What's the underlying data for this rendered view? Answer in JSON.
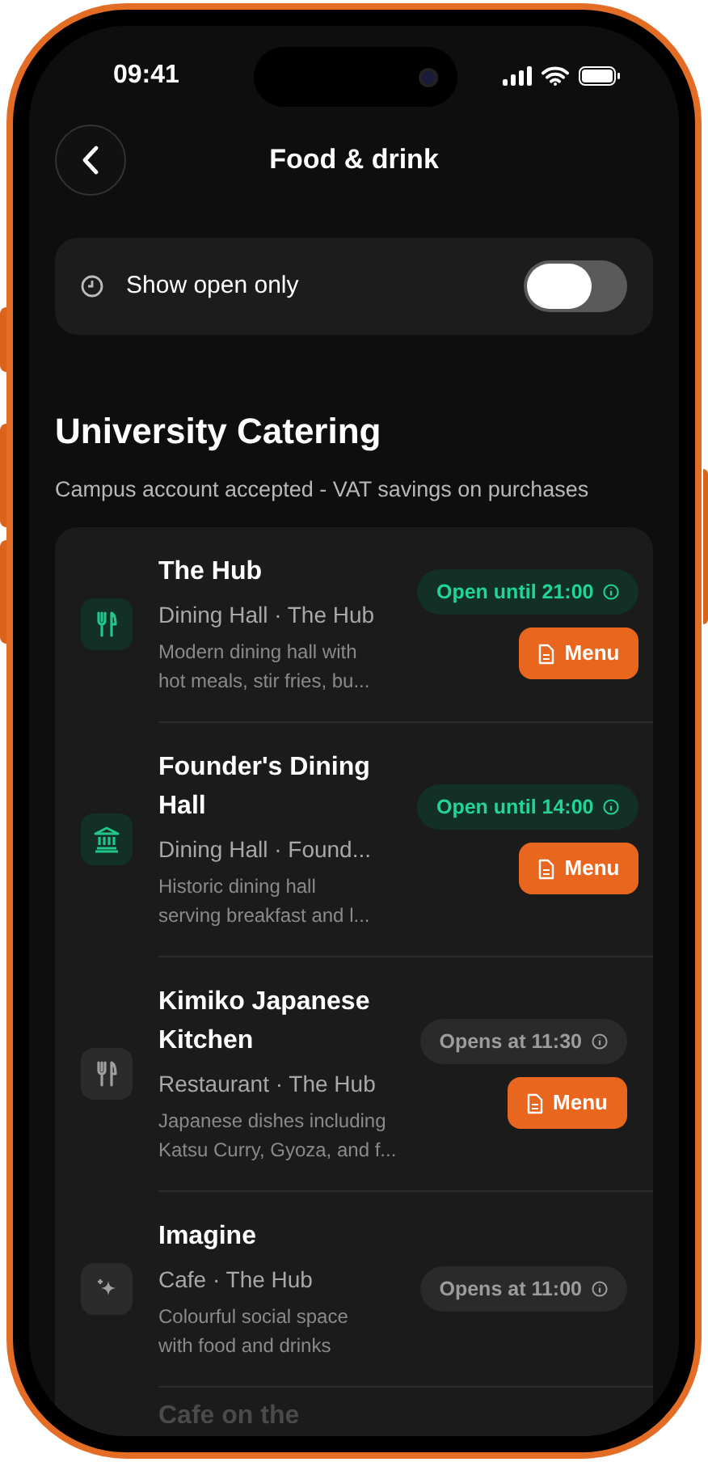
{
  "status_bar": {
    "time": "09:41"
  },
  "header": {
    "title": "Food & drink"
  },
  "filter": {
    "label": "Show open only",
    "on": false
  },
  "section": {
    "title": "University Catering",
    "subtitle": "Campus account accepted - VAT savings on purchases"
  },
  "venues": [
    {
      "kind": "dining",
      "name": "The Hub",
      "subtitle": "Dining Hall · The Hub",
      "description": "Modern dining hall with\nhot meals, stir fries, bu...",
      "open": true,
      "status": "Open until 21:00",
      "menu": "Menu"
    },
    {
      "kind": "landmark",
      "name": "Founder's Dining\nHall",
      "subtitle": "Dining Hall · Found...",
      "description": "Historic dining hall\nserving breakfast and l...",
      "open": true,
      "status": "Open until 14:00",
      "menu": "Menu"
    },
    {
      "kind": "dining",
      "name": "Kimiko Japanese\nKitchen",
      "subtitle": "Restaurant · The Hub",
      "description": "Japanese dishes including\nKatsu Curry, Gyoza, and f...",
      "open": false,
      "status": "Opens at 11:30",
      "menu": "Menu"
    },
    {
      "kind": "cafe",
      "name": "Imagine",
      "subtitle": "Cafe · The Hub",
      "description": "Colourful social space\nwith food and drinks",
      "open": false,
      "status": "Opens at 11:00"
    },
    {
      "kind": "partial",
      "name": "Cafe on the",
      "faded": true
    }
  ]
}
